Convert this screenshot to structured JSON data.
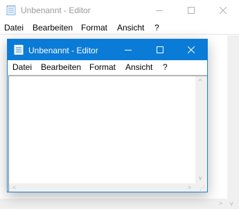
{
  "background_window": {
    "title": "Unbenannt - Editor",
    "menu": [
      "Datei",
      "Bearbeiten",
      "Format",
      "Ansicht",
      "?"
    ],
    "state": "inactive"
  },
  "foreground_window": {
    "title": "Unbenannt - Editor",
    "menu": [
      "Datei",
      "Bearbeiten",
      "Format",
      "Ansicht",
      "?"
    ],
    "editor_text": "",
    "state": "active"
  },
  "icons": {
    "app": "notepad-icon",
    "minimize": "minimize-icon",
    "maximize": "maximize-icon",
    "close": "close-icon",
    "scroll_up": "chevron-up-icon",
    "scroll_down": "chevron-down-icon",
    "scroll_left": "chevron-left-icon",
    "scroll_right": "chevron-right-icon",
    "grip": "resize-grip-icon"
  },
  "arrows": {
    "up": "^",
    "down": "v",
    "left": "<",
    "right": ">"
  },
  "colors": {
    "active_titlebar": "#0a7bd6",
    "inactive_title_text": "#999999",
    "scrollbar_track": "#f0f0f0"
  }
}
